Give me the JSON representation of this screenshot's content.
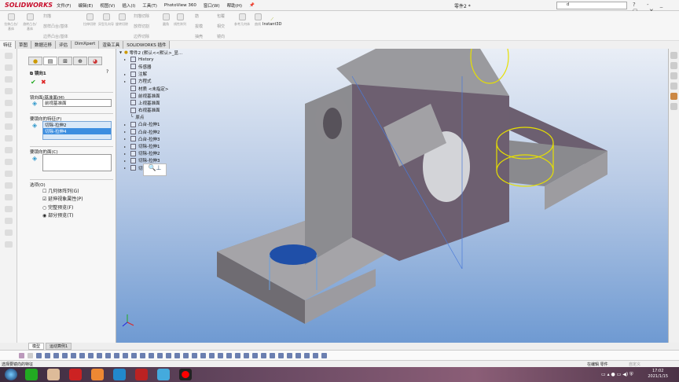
{
  "app": {
    "logo": "SOLIDWORKS",
    "title": "零件2 *",
    "search_value": "d",
    "window_buttons": "? - _ ▢ ✕"
  },
  "menu": [
    "文件(F)",
    "编辑(E)",
    "视图(V)",
    "插入(I)",
    "工具(T)",
    "PhotoView 360",
    "窗口(W)",
    "帮助(H)"
  ],
  "ribbon": {
    "items": [
      "拉伸凸台/基体",
      "旋转凸台/基体",
      "扫描",
      "放样凸台/基体",
      "边界凸台/基体",
      "拉伸切除",
      "异型孔向导",
      "旋转切除",
      "扫描切除",
      "放样切割",
      "边界切除",
      "圆角",
      "线性阵列",
      "筋",
      "拔模",
      "抽壳",
      "包覆",
      "相交",
      "镜向",
      "参考几何体",
      "曲线",
      "Instant3D"
    ]
  },
  "tabs": [
    "特征",
    "草图",
    "数据迁移",
    "评估",
    "DimXpert",
    "渲染工具",
    "SOLIDWORKS 插件"
  ],
  "property_manager": {
    "title": "镜向1",
    "ok": "✔",
    "cancel": "✖",
    "help": "?",
    "mirror_face_label": "镜向面/基准面(M)",
    "mirror_face_value": "前视基准面",
    "features_label": "要镜向的特征(F)",
    "features": [
      "切除-拉伸2",
      "切除-拉伸4"
    ],
    "faces_label": "要镜向的面(C)",
    "options_label": "选项(O)",
    "opt_geometry_pattern": "几何体阵列(G)",
    "opt_propagate": "延伸视象属性(P)",
    "opt_full_preview": "完整预览(F)",
    "opt_partial_preview": "部分预览(T)"
  },
  "tree": {
    "root": "零件2 (默认<<默认>_显...",
    "items": [
      "History",
      "传感器",
      "注解",
      "方程式",
      "材质 <未指定>",
      "前视基准面",
      "上视基准面",
      "右视基准面",
      "原点",
      "凸台-拉伸1",
      "凸台-拉伸2",
      "凸台-拉伸3",
      "切除-拉伸1",
      "切除-拉伸2",
      "切除-拉伸3",
      "切除-拉伸4"
    ]
  },
  "bottom_tabs": [
    "模型",
    "运动算例1"
  ],
  "status": {
    "left": "选择要镜向的特征",
    "right": "在编辑 零件",
    "units": "自定义"
  },
  "clock": {
    "time": "17:02",
    "date": "2021/1/15"
  },
  "colors": {
    "accent": "#c8102e",
    "viewport_bottom": "#6f9ad2",
    "model_face": "#7a6a7e",
    "highlight": "#e6e000"
  }
}
